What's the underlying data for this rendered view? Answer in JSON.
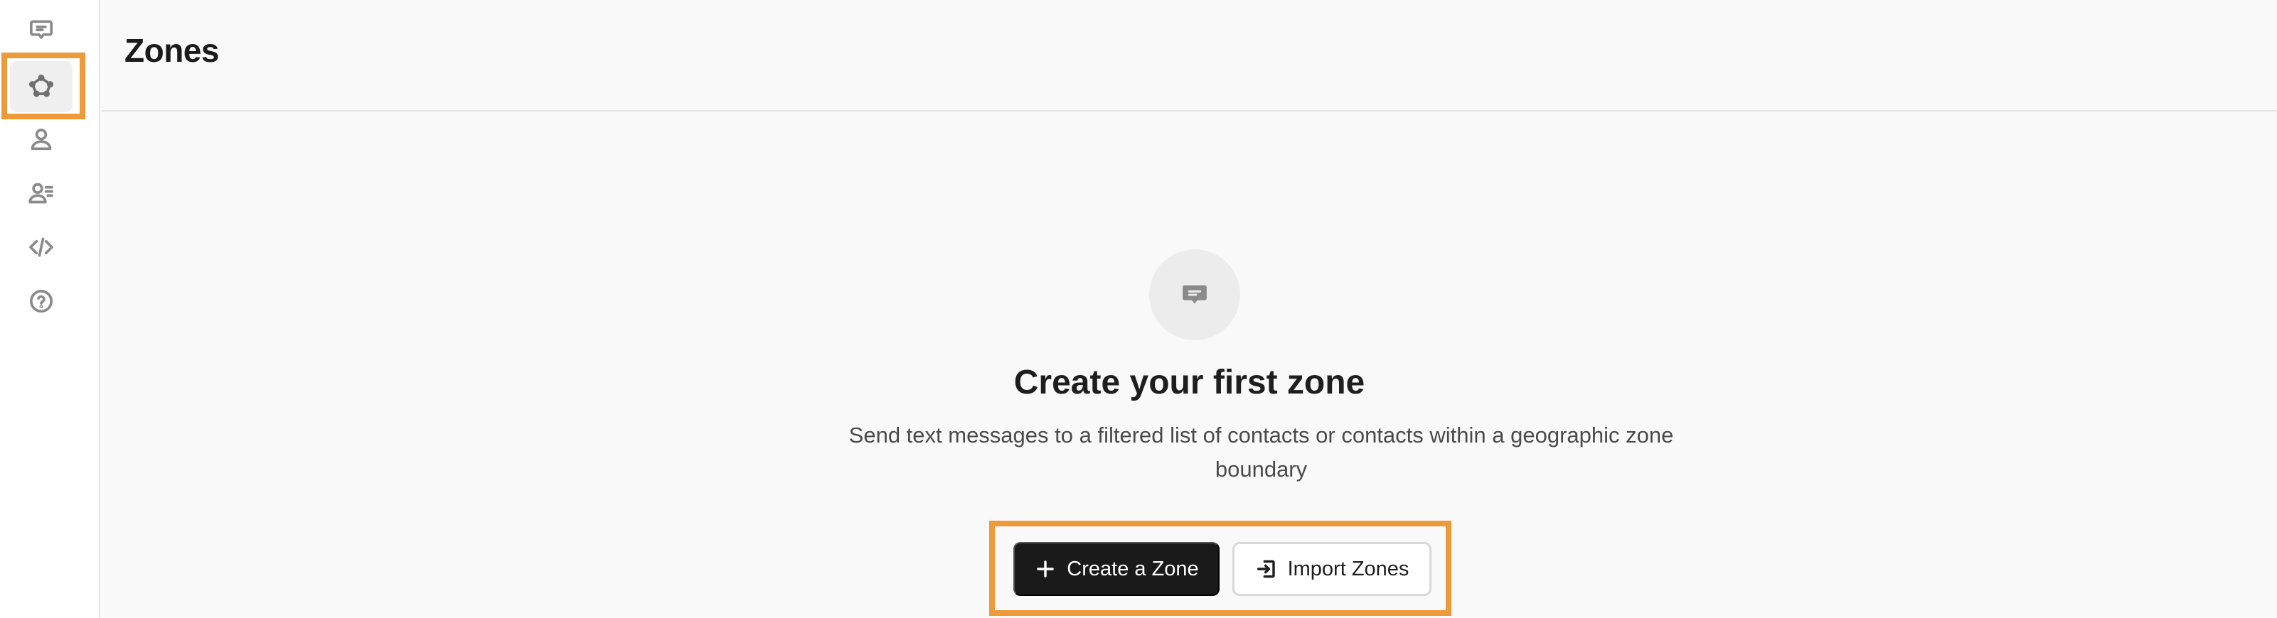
{
  "sidebar": {
    "items": [
      {
        "name": "messages",
        "icon": "message-icon",
        "active": false
      },
      {
        "name": "zones",
        "icon": "polygon-zone-icon",
        "active": true
      },
      {
        "name": "contact",
        "icon": "user-icon",
        "active": false
      },
      {
        "name": "contacts-list",
        "icon": "user-list-icon",
        "active": false
      },
      {
        "name": "developer",
        "icon": "code-icon",
        "active": false
      },
      {
        "name": "help",
        "icon": "help-circle-icon",
        "active": false
      }
    ]
  },
  "header": {
    "title": "Zones"
  },
  "empty_state": {
    "icon": "message-icon",
    "title": "Create your first zone",
    "description": "Send text messages to a filtered list of contacts or contacts within a geographic zone boundary",
    "primary_button": {
      "label": "Create a Zone",
      "icon": "plus-icon"
    },
    "secondary_button": {
      "label": "Import Zones",
      "icon": "import-icon"
    }
  },
  "colors": {
    "highlight": "#ec9a3a",
    "primary_button": "#1a1a1a",
    "background": "#f9f9f9"
  }
}
